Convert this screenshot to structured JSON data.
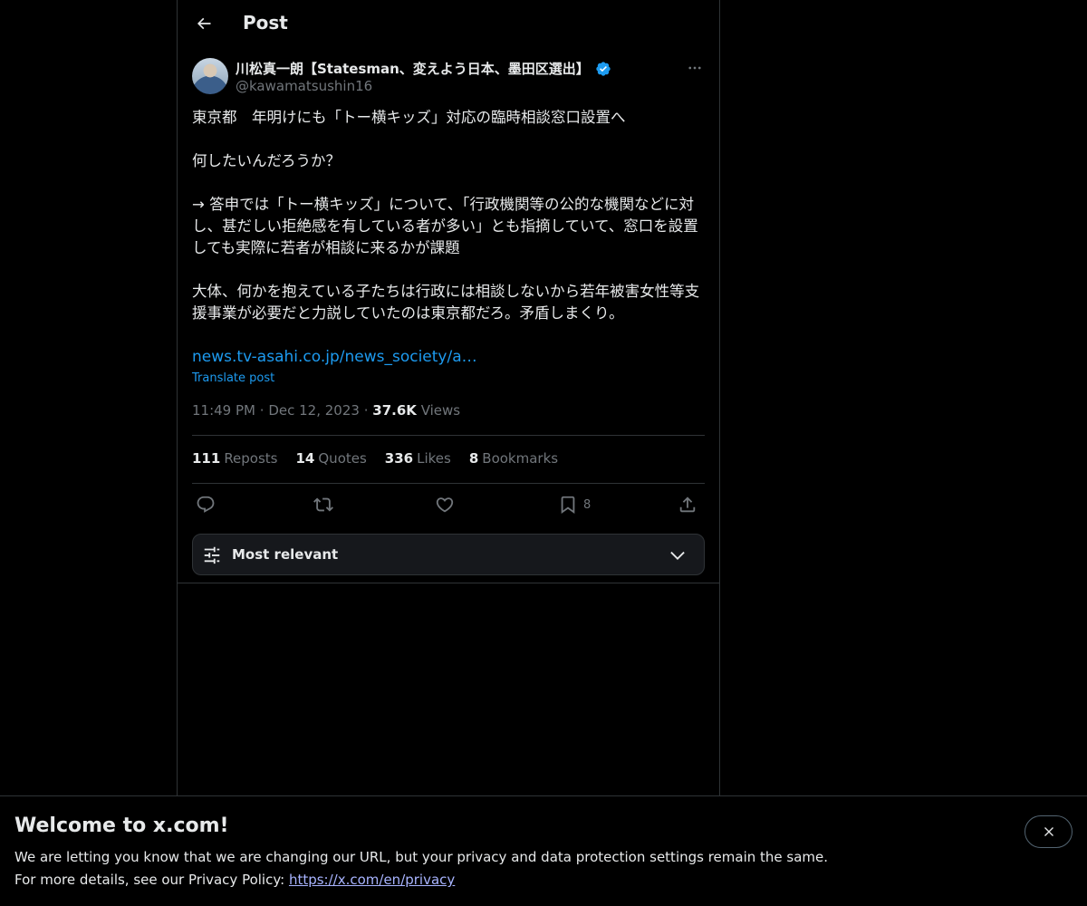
{
  "header": {
    "title": "Post"
  },
  "author": {
    "name": "川松真一朗【Statesman、変えよう日本、墨田区選出】",
    "handle": "@kawamatsushin16"
  },
  "tweet": {
    "paragraphs": [
      "東京都　年明けにも「トー横キッズ」対応の臨時相談窓口設置へ",
      "何したいんだろうか？",
      "→ 答申では「トー横キッズ」について、「行政機関等の公的な機関などに対し、甚だしい拒絶感を有している者が多い」とも指摘していて、窓口を設置しても実際に若者が相談に来るかが課題",
      "大体、何かを抱えている子たちは行政には相談しないから若年被害女性等支援事業が必要だと力説していたのは東京都だろ。矛盾しまくり。"
    ],
    "link": "news.tv-asahi.co.jp/news_society/a…",
    "translate_label": "Translate post",
    "time": "11:49 PM",
    "date": "Dec 12, 2023",
    "views_count": "37.6K",
    "views_label": "Views",
    "separator": "·"
  },
  "stats": {
    "reposts_count": "111",
    "reposts_label": "Reposts",
    "quotes_count": "14",
    "quotes_label": "Quotes",
    "likes_count": "336",
    "likes_label": "Likes",
    "bookmarks_count": "8",
    "bookmarks_label": "Bookmarks"
  },
  "actions": {
    "bookmark_count": "8"
  },
  "sort": {
    "label": "Most relevant"
  },
  "banner": {
    "title": "Welcome to x.com!",
    "line1": "We are letting you know that we are changing our URL, but your privacy and data protection settings remain the same.",
    "line2_prefix": "For more details, see our Privacy Policy: ",
    "link": "https://x.com/en/privacy"
  },
  "colors": {
    "background": "#000000",
    "text_primary": "#e7e9ea",
    "text_secondary": "#71767b",
    "accent": "#1d9bf0",
    "border": "#2f3336"
  }
}
